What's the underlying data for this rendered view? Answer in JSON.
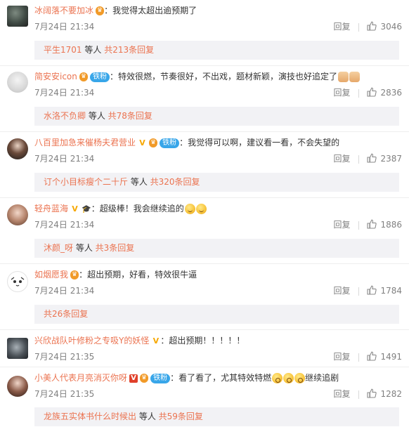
{
  "colors": {
    "username": "#eb7350",
    "link": "#eb7350",
    "muted": "#808080",
    "reply_bg": "#f2f2f5",
    "fan_badge": "#38a6e9"
  },
  "actions": {
    "reply_label": "回复"
  },
  "comments": [
    {
      "username": "冰阔落不要加冰",
      "text": "：我觉得太超出逾预期了",
      "time": "7月24日 21:34",
      "likes": "3046",
      "replies": {
        "names": "平生1701",
        "middle": " 等人 ",
        "count": "共213条回复"
      },
      "icons": [
        "level-badge-icon"
      ]
    },
    {
      "username": "简安安icon",
      "fan": "铁粉",
      "text": "：特效很燃，节奏很好，不出戏，题材新颖，演技也好追定了",
      "time": "7月24日 21:34",
      "likes": "2836",
      "replies": {
        "names": "水洛不负卿",
        "middle": " 等人 ",
        "count": "共78条回复"
      },
      "icons": [
        "level-badge-icon",
        "fist-emoji-icon",
        "fist-emoji-icon"
      ]
    },
    {
      "username": "八百里加急来催杨夫君营业",
      "fan": "铁粉",
      "text": "：我觉得可以啊，建议看一看，不会失望的",
      "time": "7月24日 21:34",
      "likes": "2387",
      "replies": {
        "names": "订个小目标瘦个二十斤",
        "middle": " 等人 ",
        "count": "共320条回复"
      },
      "icons": [
        "verified-v-icon",
        "level-badge-icon"
      ]
    },
    {
      "username": "轻舟蓝海",
      "text": "：超级棒！我会继续追的",
      "time": "7月24日 21:34",
      "likes": "1886",
      "replies": {
        "names": "沐颜_呀",
        "middle": " 等人 ",
        "count": "共3条回复"
      },
      "icons": [
        "verified-v-icon",
        "graduation-cap-icon",
        "smile-emoji-icon",
        "smile-emoji-icon"
      ]
    },
    {
      "username": "如烟愿我",
      "text": "：超出预期，好看，特效很牛逼",
      "time": "7月24日 21:34",
      "likes": "1784",
      "replies": {
        "names": "",
        "middle": "",
        "count": "共26条回复"
      },
      "icons": [
        "level-badge-icon"
      ]
    },
    {
      "username": "兴欣战队叶修粉之专吸Y的妖怪",
      "text": "：超出预期！！！！！",
      "time": "7月24日 21:35",
      "likes": "1491",
      "icons": [
        "verified-v-icon"
      ]
    },
    {
      "username": "小美人代表月亮消灭你呀",
      "fan": "铁粉",
      "text": "：看了看了，尤其特效特燃",
      "text_tail": "继续追剧",
      "time": "7月24日 21:35",
      "likes": "1282",
      "replies": {
        "names": "龙族五实体书什么时候出",
        "middle": " 等人 ",
        "count": "共59条回复"
      },
      "icons": [
        "red-v-icon",
        "level-badge-icon",
        "shock-emoji-icon",
        "shock-emoji-icon",
        "shock-emoji-icon"
      ]
    }
  ]
}
